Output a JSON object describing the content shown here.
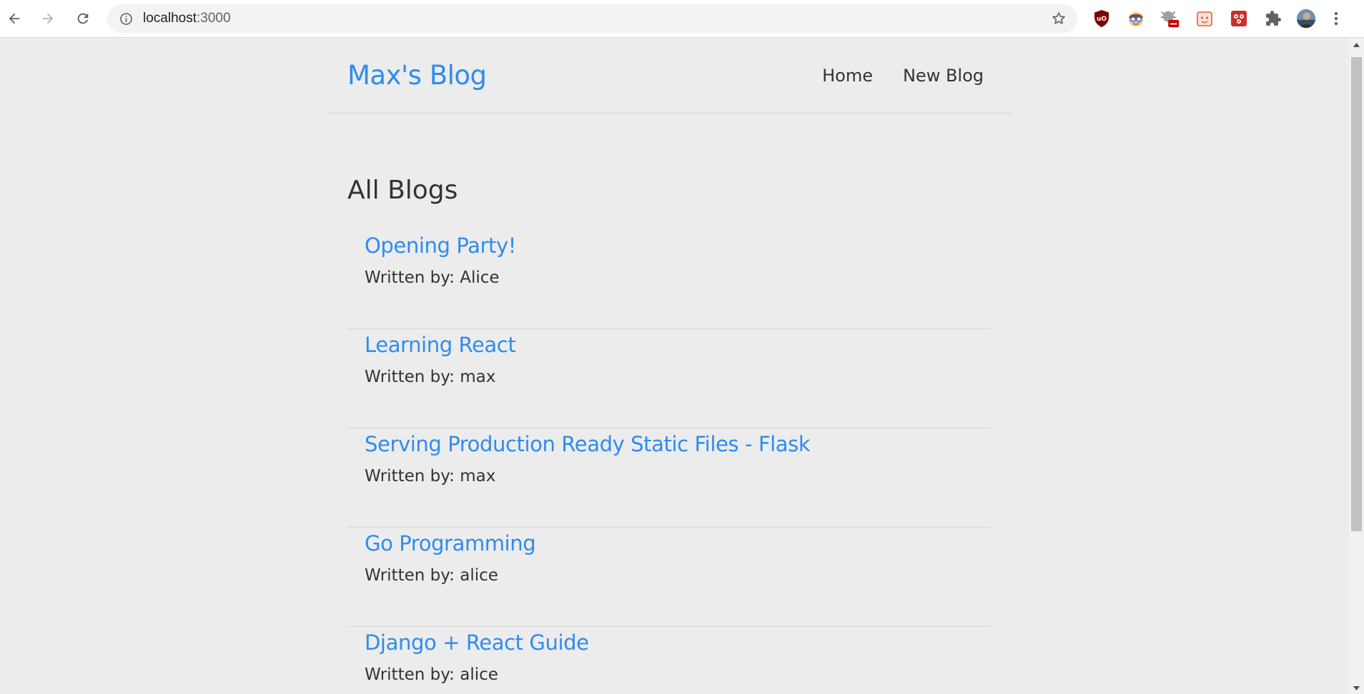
{
  "browser": {
    "url_host": "localhost",
    "url_port": ":3000",
    "icons": {
      "back": "arrow-left-icon",
      "forward": "arrow-right-icon",
      "reload": "reload-icon",
      "info": "info-icon",
      "bookmark": "star-icon",
      "extensions": [
        "ublock-shield-icon",
        "face-extension-icon",
        "bug-extension-icon",
        "face-outline-extension-icon",
        "red-extension-icon",
        "puzzle-icon",
        "profile-avatar",
        "more-vert-icon"
      ]
    }
  },
  "site": {
    "brand": "Max's Blog",
    "nav": [
      {
        "label": "Home"
      },
      {
        "label": "New Blog"
      }
    ],
    "accent_color": "#2e8cf0",
    "text_color": "#333333"
  },
  "main": {
    "heading": "All Blogs",
    "blogs": [
      {
        "title": "Opening Party!",
        "author": "Written by: Alice"
      },
      {
        "title": "Learning React",
        "author": "Written by: max"
      },
      {
        "title": "Serving Production Ready Static Files - Flask",
        "author": "Written by: max"
      },
      {
        "title": "Go Programming",
        "author": "Written by: alice"
      },
      {
        "title": "Django + React Guide",
        "author": "Written by: alice"
      }
    ]
  }
}
